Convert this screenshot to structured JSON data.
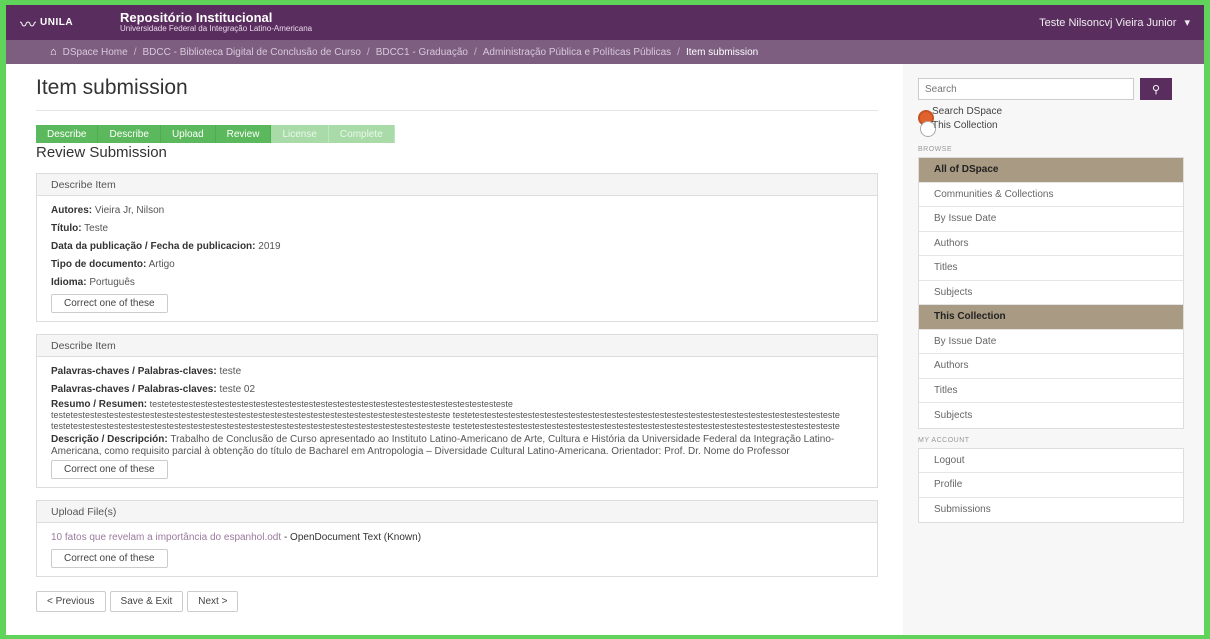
{
  "header": {
    "logo_text": "UNILA",
    "title": "Repositório Institucional",
    "subtitle": "Universidade Federal da Integração Latino-Americana",
    "user": "Teste Nilsoncvj Vieira Junior"
  },
  "breadcrumb": [
    "DSpace Home",
    "BDCC - Biblioteca Digital de Conclusão de Curso",
    "BDCC1 - Graduação",
    "Administração Pública e Políticas Públicas",
    "Item submission"
  ],
  "main": {
    "title": "Item submission",
    "steps": [
      "Describe",
      "Describe",
      "Upload",
      "Review",
      "License",
      "Complete"
    ],
    "subtitle": "Review Submission",
    "panel1": {
      "header": "Describe Item",
      "fields": [
        {
          "label": "Autores:",
          "value": "Vieira Jr, Nilson"
        },
        {
          "label": "Título:",
          "value": "Teste"
        },
        {
          "label": "Data da publicação / Fecha de publicacion:",
          "value": "2019"
        },
        {
          "label": "Tipo de documento:",
          "value": "Artigo"
        },
        {
          "label": "Idioma:",
          "value": "Português"
        }
      ],
      "button": "Correct one of these"
    },
    "panel2": {
      "header": "Describe Item",
      "fields": [
        {
          "label": "Palavras-chaves / Palabras-claves:",
          "value": "teste"
        },
        {
          "label": "Palavras-chaves / Palabras-claves:",
          "value": "teste 02"
        }
      ],
      "resumo_label": "Resumo / Resumen:",
      "resumo_line1": "testetestestestestestestestestestestestestestestestestestestestestestestestestestestesteste",
      "resumo_line2": "testetestestestestestestestestestestestestestestestestestestestestestestestestestestestestestesteste testetestestestestestestestestestestestestestestestestestestestestestestestestestestestestesteste",
      "resumo_line3": "testetestestestestestestestestestestestestestestestestestestestestestestestestestestestestestesteste testetestestestestestestestestestestestestestestestestestestestestestestestestestestestestesteste",
      "desc_label": "Descrição / Descripción:",
      "desc_value": "Trabalho de Conclusão de Curso apresentado ao Instituto Latino-Americano de Arte, Cultura e História da Universidade Federal da Integração Latino-Americana, como requisito parcial à obtenção do título de Bacharel em Antropologia – Diversidade Cultural Latino-Americana. Orientador: Prof. Dr. Nome do Professor",
      "button": "Correct one of these"
    },
    "panel3": {
      "header": "Upload File(s)",
      "file_name": "10 fatos que revelam a importância do espanhol.odt",
      "file_meta": "- OpenDocument Text (Known)",
      "button": "Correct one of these"
    },
    "nav": {
      "previous": "< Previous",
      "save": "Save & Exit",
      "next": "Next >"
    }
  },
  "sidebar": {
    "search_placeholder": "Search",
    "scope1": "Search DSpace",
    "scope2": "This Collection",
    "browse_label": "BROWSE",
    "browse_all_head": "All of DSpace",
    "browse_all": [
      "Communities & Collections",
      "By Issue Date",
      "Authors",
      "Titles",
      "Subjects"
    ],
    "browse_coll_head": "This Collection",
    "browse_coll": [
      "By Issue Date",
      "Authors",
      "Titles",
      "Subjects"
    ],
    "account_label": "MY ACCOUNT",
    "account": [
      "Logout",
      "Profile",
      "Submissions"
    ]
  },
  "colors": {
    "brand": "#5a2d5f",
    "step_done": "#5cb85c",
    "step_pending": "#a9dba9",
    "list_head": "#a89a83"
  }
}
